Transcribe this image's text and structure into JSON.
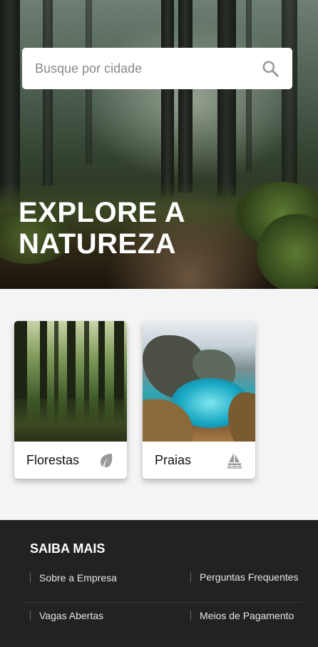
{
  "search": {
    "placeholder": "Busque por cidade",
    "icon": "search-icon"
  },
  "hero": {
    "title_line1": "EXPLORE A",
    "title_line2": "NATUREZA"
  },
  "cards": [
    {
      "label": "Florestas",
      "icon": "leaf-icon"
    },
    {
      "label": "Praias",
      "icon": "sailboat-icon"
    }
  ],
  "footer": {
    "title": "SAIBA MAIS",
    "links": [
      "Sobre a Empresa",
      "Perguntas Frequentes",
      "Vagas Abertas",
      "Meios de Pagamento"
    ]
  },
  "colors": {
    "footer_bg": "#222222",
    "page_bg": "#f4f4f4",
    "hero_text": "#ffffff",
    "icon_gray": "#9a9a9a"
  }
}
